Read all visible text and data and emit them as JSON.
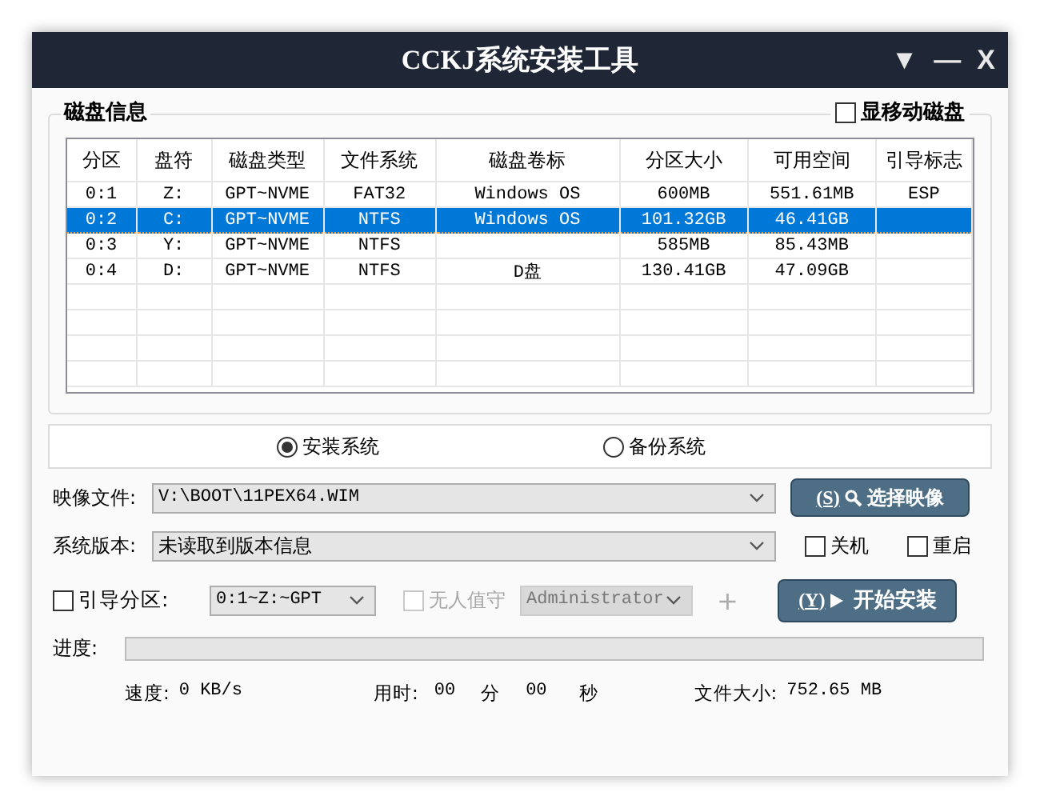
{
  "window": {
    "title": "CCKJ系统安装工具",
    "controls": [
      "▼",
      "—",
      "X"
    ]
  },
  "disk_info": {
    "title": "磁盘信息",
    "show_removable": {
      "label": "显移动磁盘",
      "checked": false
    },
    "table": {
      "columns": [
        "分区",
        "盘符",
        "磁盘类型",
        "文件系统",
        "磁盘卷标",
        "分区大小",
        "可用空间",
        "引导标志"
      ],
      "rows": [
        {
          "cells": [
            "0:1",
            "Z:",
            "GPT~NVME",
            "FAT32",
            "Windows OS",
            "600MB",
            "551.61MB",
            "ESP"
          ],
          "selected": false
        },
        {
          "cells": [
            "0:2",
            "C:",
            "GPT~NVME",
            "NTFS",
            "Windows OS",
            "101.32GB",
            "46.41GB",
            ""
          ],
          "selected": true
        },
        {
          "cells": [
            "0:3",
            "Y:",
            "GPT~NVME",
            "NTFS",
            "",
            "585MB",
            "85.43MB",
            ""
          ],
          "selected": false
        },
        {
          "cells": [
            "0:4",
            "D:",
            "GPT~NVME",
            "NTFS",
            "D盘",
            "130.41GB",
            "47.09GB",
            ""
          ],
          "selected": false
        }
      ]
    }
  },
  "mode": [
    {
      "label": "安装系统",
      "selected": true
    },
    {
      "label": "备份系统",
      "selected": false
    }
  ],
  "image_file": {
    "label": "映像文件:",
    "value": "V:\\BOOT\\11PEX64.WIM"
  },
  "select_image_button": {
    "hotkey": "(S)",
    "label": "选择映像"
  },
  "system_version": {
    "label": "系统版本:",
    "value": "未读取到版本信息"
  },
  "shutdown": {
    "label": "关机",
    "checked": false
  },
  "restart": {
    "label": "重启",
    "checked": false
  },
  "boot_partition": {
    "label": "引导分区:",
    "checked": false,
    "value": "0:1~Z:~GPT"
  },
  "unattended": {
    "label": "无人值守",
    "checked": false,
    "disabled": true,
    "account": "Administrator",
    "add": "+"
  },
  "start_button": {
    "hotkey": "(Y)",
    "label": "开始安装"
  },
  "progress": {
    "label": "进度:",
    "level": 0
  },
  "stats": {
    "speed_label": "速度:",
    "speed": "0 KB/s",
    "time_label": "用时:",
    "minutes": "00",
    "minutes_unit": "分",
    "seconds": "00",
    "seconds_unit": "秒",
    "size_label": "文件大小:",
    "size": "752.65 MB"
  }
}
